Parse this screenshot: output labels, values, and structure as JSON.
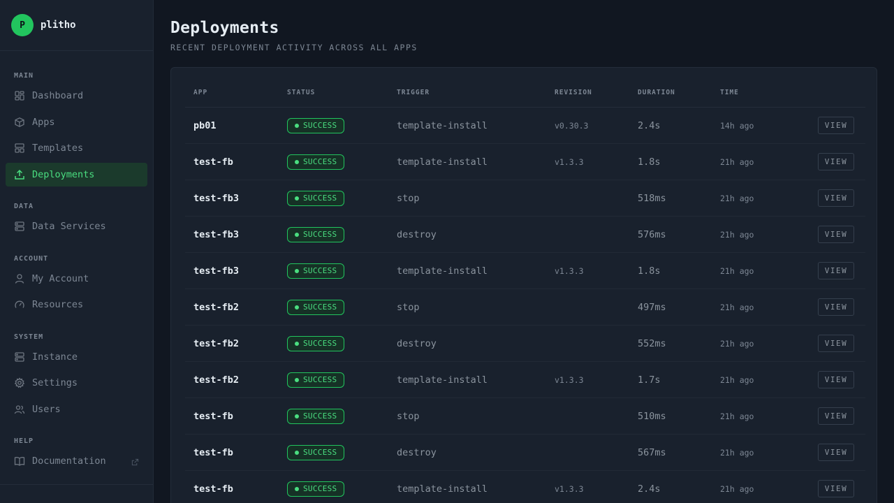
{
  "brand": {
    "logo_letter": "P",
    "name": "plitho",
    "accent": "#22c55e"
  },
  "sidebar": {
    "sections": {
      "main": "MAIN",
      "data": "DATA",
      "account": "ACCOUNT",
      "system": "SYSTEM",
      "help": "HELP"
    },
    "items": {
      "dashboard": "Dashboard",
      "apps": "Apps",
      "templates": "Templates",
      "deployments": "Deployments",
      "data_services": "Data Services",
      "my_account": "My Account",
      "resources": "Resources",
      "instance": "Instance",
      "settings": "Settings",
      "users": "Users",
      "documentation": "Documentation"
    },
    "active": "deployments"
  },
  "page": {
    "title": "Deployments",
    "subtitle": "RECENT DEPLOYMENT ACTIVITY ACROSS ALL APPS"
  },
  "table": {
    "headers": {
      "app": "APP",
      "status": "STATUS",
      "trigger": "TRIGGER",
      "revision": "REVISION",
      "duration": "DURATION",
      "time": "TIME"
    },
    "rows": [
      {
        "app": "pb01",
        "status": "SUCCESS",
        "trigger": "template-install",
        "revision": "v0.30.3",
        "duration": "2.4s",
        "time": "14h ago",
        "action": "VIEW"
      },
      {
        "app": "test-fb",
        "status": "SUCCESS",
        "trigger": "template-install",
        "revision": "v1.3.3",
        "duration": "1.8s",
        "time": "21h ago",
        "action": "VIEW"
      },
      {
        "app": "test-fb3",
        "status": "SUCCESS",
        "trigger": "stop",
        "revision": "",
        "duration": "518ms",
        "time": "21h ago",
        "action": "VIEW"
      },
      {
        "app": "test-fb3",
        "status": "SUCCESS",
        "trigger": "destroy",
        "revision": "",
        "duration": "576ms",
        "time": "21h ago",
        "action": "VIEW"
      },
      {
        "app": "test-fb3",
        "status": "SUCCESS",
        "trigger": "template-install",
        "revision": "v1.3.3",
        "duration": "1.8s",
        "time": "21h ago",
        "action": "VIEW"
      },
      {
        "app": "test-fb2",
        "status": "SUCCESS",
        "trigger": "stop",
        "revision": "",
        "duration": "497ms",
        "time": "21h ago",
        "action": "VIEW"
      },
      {
        "app": "test-fb2",
        "status": "SUCCESS",
        "trigger": "destroy",
        "revision": "",
        "duration": "552ms",
        "time": "21h ago",
        "action": "VIEW"
      },
      {
        "app": "test-fb2",
        "status": "SUCCESS",
        "trigger": "template-install",
        "revision": "v1.3.3",
        "duration": "1.7s",
        "time": "21h ago",
        "action": "VIEW"
      },
      {
        "app": "test-fb",
        "status": "SUCCESS",
        "trigger": "stop",
        "revision": "",
        "duration": "510ms",
        "time": "21h ago",
        "action": "VIEW"
      },
      {
        "app": "test-fb",
        "status": "SUCCESS",
        "trigger": "destroy",
        "revision": "",
        "duration": "567ms",
        "time": "21h ago",
        "action": "VIEW"
      },
      {
        "app": "test-fb",
        "status": "SUCCESS",
        "trigger": "template-install",
        "revision": "v1.3.3",
        "duration": "2.4s",
        "time": "21h ago",
        "action": "VIEW"
      }
    ]
  }
}
